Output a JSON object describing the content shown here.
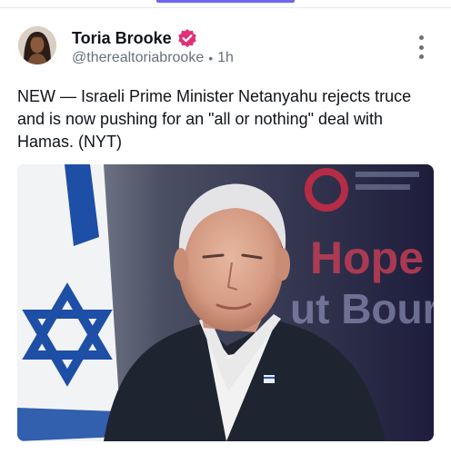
{
  "post": {
    "author": {
      "display_name": "Toria Brooke",
      "handle": "@therealtoriabrooke",
      "verified": true,
      "verified_icon": "verified-badge-icon",
      "avatar_icon": "avatar"
    },
    "timestamp": "1h",
    "separator": "•",
    "text": "NEW — Israeli Prime Minister Netanyahu rejects truce and is now pushing for an \"all or nothing\" deal with Hamas. (NYT)",
    "media": {
      "background_text_line1": "Hope",
      "background_text_line2": "ut Bour"
    },
    "more_icon": "more-vertical-icon"
  },
  "colors": {
    "accent": "#6e66f0",
    "verified_badge": "#e0307a",
    "text_primary": "#0f1419",
    "text_secondary": "#68707a"
  }
}
